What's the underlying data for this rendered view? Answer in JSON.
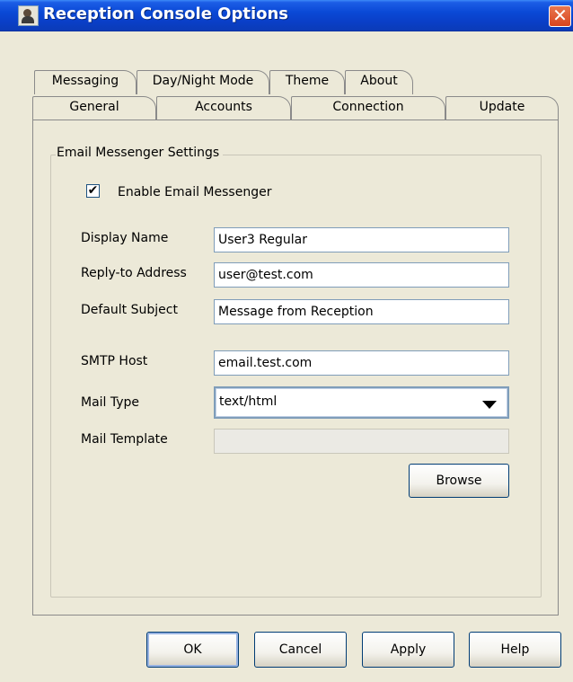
{
  "window": {
    "title": "Reception Console Options",
    "close_glyph": "✕",
    "icon": "app-user-icon"
  },
  "tabs_row_back": [
    {
      "label": "Messaging",
      "selected": true
    },
    {
      "label": "Day/Night Mode"
    },
    {
      "label": "Theme"
    },
    {
      "label": "About"
    }
  ],
  "tabs_row_front": [
    {
      "label": "General"
    },
    {
      "label": "Accounts"
    },
    {
      "label": "Connection"
    },
    {
      "label": "Update"
    }
  ],
  "group": {
    "title": "Email Messenger Settings",
    "enable": {
      "label": "Enable Email Messenger",
      "checked": true,
      "check_glyph": "✔"
    },
    "fields": {
      "display_name": {
        "label": "Display Name",
        "value": "User3 Regular"
      },
      "reply_to": {
        "label": "Reply-to Address",
        "value": "user@test.com"
      },
      "default_subject": {
        "label": "Default Subject",
        "value": "Message from Reception"
      },
      "smtp_host": {
        "label": "SMTP Host",
        "value": "email.test.com"
      },
      "mail_type": {
        "label": "Mail Type",
        "value": "text/html"
      },
      "mail_template": {
        "label": "Mail Template",
        "value": ""
      }
    },
    "browse_label": "Browse"
  },
  "buttons": {
    "ok": "OK",
    "cancel": "Cancel",
    "apply": "Apply",
    "help": "Help"
  },
  "colors": {
    "titlebar": "#0a49d6",
    "dialog_bg": "#ece9d8",
    "close_button": "#d9441e"
  }
}
